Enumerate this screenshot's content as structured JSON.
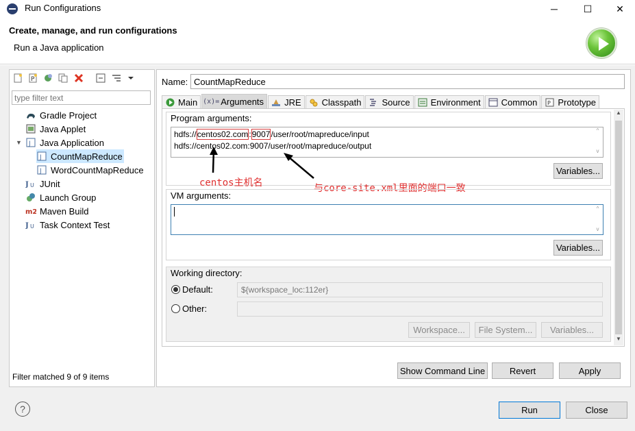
{
  "window": {
    "title": "Run Configurations",
    "minimize": "─",
    "maximize": "☐",
    "close": "✕"
  },
  "header": {
    "title": "Create, manage, and run configurations",
    "subtitle": "Run a Java application"
  },
  "left": {
    "filter_placeholder": "type filter text",
    "tree": [
      {
        "label": "Gradle Project",
        "icon": "gradle-icon"
      },
      {
        "label": "Java Applet",
        "icon": "java-applet-icon"
      },
      {
        "label": "Java Application",
        "icon": "java-application-icon",
        "expanded": true
      },
      {
        "label": "CountMapReduce",
        "icon": "java-config-icon",
        "selected": true
      },
      {
        "label": "WordCountMapReduce",
        "icon": "java-config-icon"
      },
      {
        "label": "JUnit",
        "icon": "junit-icon"
      },
      {
        "label": "Launch Group",
        "icon": "launch-group-icon"
      },
      {
        "label": "Maven Build",
        "icon": "maven-icon"
      },
      {
        "label": "Task Context Test",
        "icon": "junit-icon"
      }
    ],
    "status": "Filter matched 9 of 9 items"
  },
  "right": {
    "name_label": "Name:",
    "name_value": "CountMapReduce",
    "tabs": [
      {
        "label": "Main",
        "icon": "main-tab-icon"
      },
      {
        "label": "Arguments",
        "icon": "arguments-tab-icon",
        "active": true
      },
      {
        "label": "JRE",
        "icon": "jre-tab-icon"
      },
      {
        "label": "Classpath",
        "icon": "classpath-tab-icon"
      },
      {
        "label": "Source",
        "icon": "source-tab-icon"
      },
      {
        "label": "Environment",
        "icon": "environment-tab-icon"
      },
      {
        "label": "Common",
        "icon": "common-tab-icon"
      },
      {
        "label": "Prototype",
        "icon": "prototype-tab-icon"
      }
    ],
    "program_args_label": "Program arguments:",
    "program_args_line1_prefix": "hdfs://",
    "program_args_line1_host": "centos02.com",
    "program_args_line1_colon": ":",
    "program_args_line1_port": "9007",
    "program_args_line1_path": "/user/root/mapreduce/input",
    "program_args_line2": "hdfs://centos02.com:9007/user/root/mapreduce/output",
    "variables_label": "Variables...",
    "annot_host": "centos主机名",
    "annot_port": "与core-site.xml里面的端口一致",
    "vm_args_label": "VM arguments:",
    "vm_args_value": "",
    "workdir_label": "Working directory:",
    "default_label": "Default:",
    "default_value": "${workspace_loc:112er}",
    "other_label": "Other:",
    "workspace_btn": "Workspace...",
    "filesystem_btn": "File System...",
    "variables_btn_disabled": "Variables...",
    "show_cmd_btn": "Show Command Line",
    "revert_btn": "Revert",
    "apply_btn": "Apply"
  },
  "footer": {
    "help": "?",
    "run_btn": "Run",
    "close_btn": "Close"
  },
  "colors": {
    "selection": "#cce8ff",
    "annotation_red": "#e03030",
    "focus_border": "#3c7fb1"
  }
}
